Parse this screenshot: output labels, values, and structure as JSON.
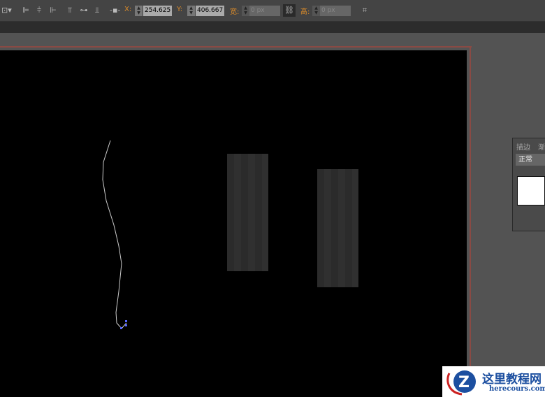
{
  "toolbar": {
    "x_label": "X:",
    "x_value": "254.625",
    "y_label": "Y:",
    "y_value": "406.667",
    "w_label": "宽:",
    "w_value": "0 px",
    "h_label": "高:",
    "h_value": "0 px"
  },
  "panel": {
    "tabs": [
      "描边",
      "渐"
    ],
    "blend_mode": "正常"
  },
  "watermark": {
    "title": "这里教程网",
    "url": "herecours.com"
  }
}
